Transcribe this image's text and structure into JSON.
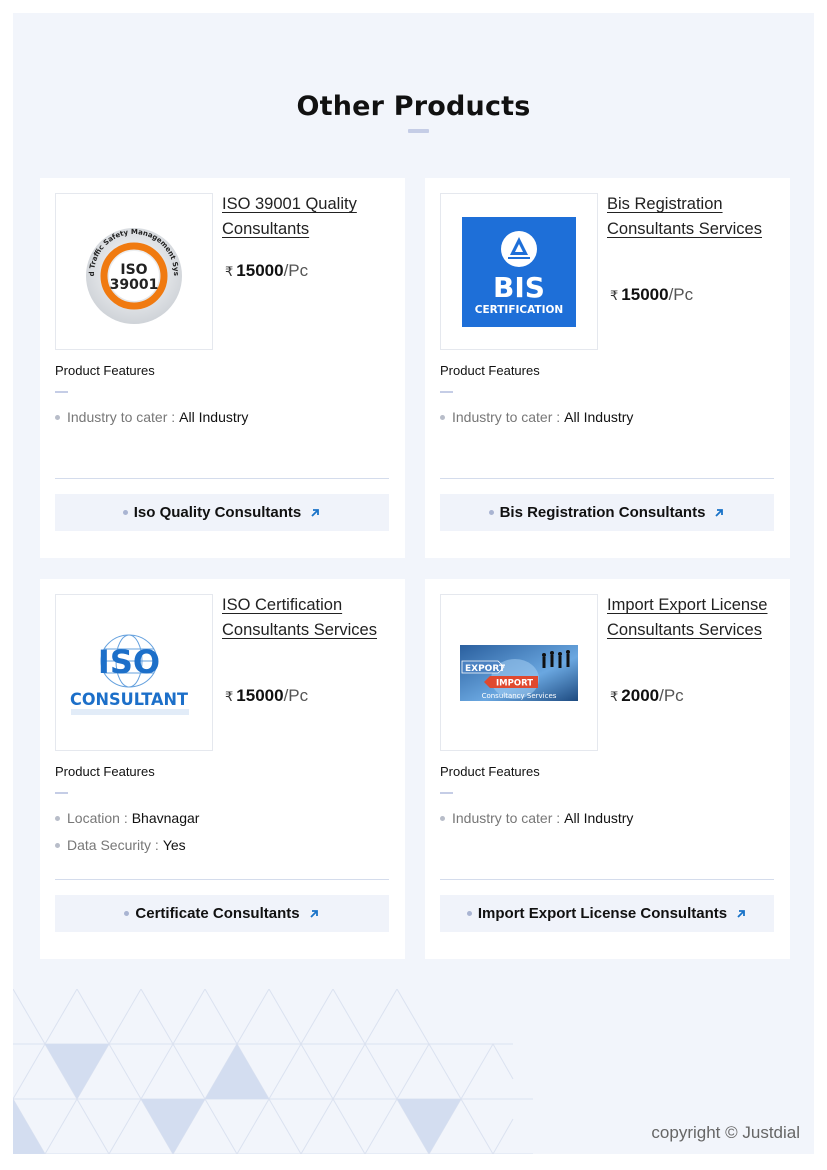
{
  "section": {
    "title": "Other Products"
  },
  "products": [
    {
      "name": "ISO 39001 Quality Consultants",
      "image_icon": "iso-39001-badge-icon",
      "currency": "₹",
      "price": "15000",
      "unit": "/Pc",
      "features_heading": "Product Features",
      "features": [
        {
          "label": "Industry to cater :",
          "value": "All Industry"
        }
      ],
      "category": "Iso Quality Consultants"
    },
    {
      "name": "Bis Registration Consultants Services",
      "image_icon": "bis-certification-logo-icon",
      "currency": "₹",
      "price": "15000",
      "unit": "/Pc",
      "features_heading": "Product Features",
      "features": [
        {
          "label": "Industry to cater :",
          "value": "All Industry"
        }
      ],
      "category": "Bis Registration Consultants"
    },
    {
      "name": "ISO Certification Consultants Services",
      "image_icon": "iso-consultant-logo-icon",
      "currency": "₹",
      "price": "15000",
      "unit": "/Pc",
      "features_heading": "Product Features",
      "features": [
        {
          "label": "Location :",
          "value": "Bhavnagar"
        },
        {
          "label": "Data Security :",
          "value": "Yes"
        }
      ],
      "category": "Certificate Consultants"
    },
    {
      "name": "Import Export License Consultants Services",
      "image_icon": "import-export-banner-icon",
      "currency": "₹",
      "price": "2000",
      "unit": "/Pc",
      "features_heading": "Product Features",
      "features": [
        {
          "label": "Industry to cater :",
          "value": "All Industry"
        }
      ],
      "category": "Import Export License Consultants"
    }
  ],
  "images": {
    "iso39001": {
      "ring_text": "Road Traffic Safety Management System",
      "line1": "ISO",
      "line2": "39001"
    },
    "bis": {
      "line1": "BIS",
      "line2": "CERTIFICATION"
    },
    "isoconsultant": {
      "line1": "ISO",
      "line2": "CONSULTANT"
    },
    "importexport": {
      "export": "EXPORT",
      "import": "IMPORT",
      "caption": "Consultancy Services"
    }
  },
  "footer": {
    "copyright": "copyright © Justdial"
  },
  "colors": {
    "accent_arrow": "#1a73c8",
    "page_bg": "#f2f5fb",
    "divider": "#d4dcec"
  }
}
